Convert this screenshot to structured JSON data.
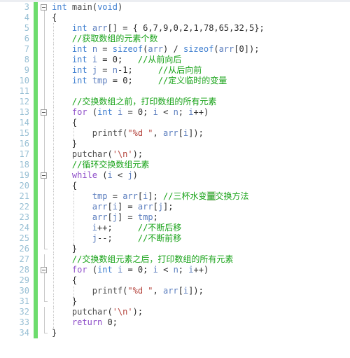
{
  "editor": {
    "app": "code-editor",
    "language": "C",
    "first_line_number": 3,
    "gutter_change_color": "#6ddc6d",
    "comment_color": "#19a319",
    "keyword_color": "#8f4fc9",
    "type_color": "#3f7fd0",
    "string_color": "#b4433c",
    "linenumber_color": "#97bfd4",
    "selection_highlight": "量"
  },
  "lines": [
    {
      "n": 3,
      "fold": "open",
      "guides": [],
      "text": "int main(void)"
    },
    {
      "n": 4,
      "fold": "stem",
      "guides": [],
      "text": "{"
    },
    {
      "n": 5,
      "fold": "stem",
      "guides": [
        0
      ],
      "text": "    int arr[] = { 6,7,9,0,2,1,78,65,32,5};"
    },
    {
      "n": 6,
      "fold": "stem",
      "guides": [
        0
      ],
      "text": "    //获取数组的元素个数"
    },
    {
      "n": 7,
      "fold": "stem",
      "guides": [
        0
      ],
      "text": "    int n = sizeof(arr) / sizeof(arr[0]);"
    },
    {
      "n": 8,
      "fold": "stem",
      "guides": [
        0
      ],
      "text": "    int i = 0;   //从前向后"
    },
    {
      "n": 9,
      "fold": "stem",
      "guides": [
        0
      ],
      "text": "    int j = n-1;     //从后向前"
    },
    {
      "n": 10,
      "fold": "stem",
      "guides": [
        0
      ],
      "text": "    int tmp = 0;     //定义临时的变量"
    },
    {
      "n": 11,
      "fold": "stem",
      "guides": [
        0
      ],
      "text": ""
    },
    {
      "n": 12,
      "fold": "stem",
      "guides": [
        0
      ],
      "text": "    //交换数组之前，打印数组的所有元素"
    },
    {
      "n": 13,
      "fold": "open",
      "guides": [
        0
      ],
      "text": "    for (int i = 0; i < n; i++)"
    },
    {
      "n": 14,
      "fold": "stem",
      "guides": [
        0
      ],
      "text": "    {"
    },
    {
      "n": 15,
      "fold": "stem",
      "guides": [
        0,
        1
      ],
      "text": "        printf(\"%d \", arr[i]);"
    },
    {
      "n": 16,
      "fold": "stem",
      "guides": [
        0,
        1
      ],
      "text": "    }"
    },
    {
      "n": 17,
      "fold": "stem",
      "guides": [
        0
      ],
      "text": "    putchar('\\n');"
    },
    {
      "n": 18,
      "fold": "stem",
      "guides": [
        0
      ],
      "text": "    //循环交换数组元素"
    },
    {
      "n": 19,
      "fold": "open",
      "guides": [
        0
      ],
      "text": "    while (i < j)"
    },
    {
      "n": 20,
      "fold": "stem",
      "guides": [
        0
      ],
      "text": "    {"
    },
    {
      "n": 21,
      "fold": "stem",
      "guides": [
        0,
        1
      ],
      "text": "        tmp = arr[i]; //三杯水变量交换方法"
    },
    {
      "n": 22,
      "fold": "stem",
      "guides": [
        0,
        1
      ],
      "text": "        arr[i] = arr[j];"
    },
    {
      "n": 23,
      "fold": "stem",
      "guides": [
        0,
        1
      ],
      "text": "        arr[j] = tmp;"
    },
    {
      "n": 24,
      "fold": "stem",
      "guides": [
        0,
        1
      ],
      "text": "        i++;     //不断后移"
    },
    {
      "n": 25,
      "fold": "stem",
      "guides": [
        0,
        1
      ],
      "text": "        j--;     //不断前移"
    },
    {
      "n": 26,
      "fold": "endbr",
      "guides": [
        0,
        1
      ],
      "text": "    }"
    },
    {
      "n": 27,
      "fold": "stem",
      "guides": [
        0
      ],
      "text": "    //交换数组元素之后，打印数组的所有元素"
    },
    {
      "n": 28,
      "fold": "open",
      "guides": [
        0
      ],
      "text": "    for (int i = 0; i < n; i++)"
    },
    {
      "n": 29,
      "fold": "stem",
      "guides": [
        0
      ],
      "text": "    {"
    },
    {
      "n": 30,
      "fold": "stem",
      "guides": [
        0,
        1
      ],
      "text": "        printf(\"%d \", arr[i]);"
    },
    {
      "n": 31,
      "fold": "endbr",
      "guides": [
        0,
        1
      ],
      "text": "    }"
    },
    {
      "n": 32,
      "fold": "stem",
      "guides": [
        0
      ],
      "text": "    putchar('\\n');"
    },
    {
      "n": 33,
      "fold": "stem",
      "guides": [
        0
      ],
      "text": "    return 0;"
    },
    {
      "n": 34,
      "fold": "endbr",
      "guides": [],
      "text": "}"
    }
  ]
}
